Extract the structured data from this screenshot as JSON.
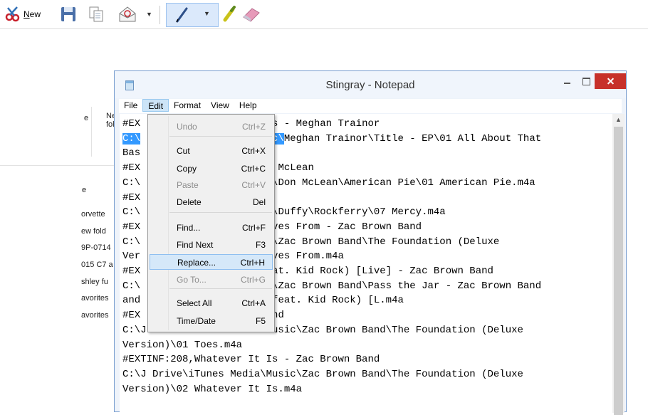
{
  "toolbar": {
    "new_label": "New"
  },
  "explorer": {
    "fragments": [
      "e",
      "Ne",
      "fol",
      "e",
      "orvette",
      "ew fold",
      "9P-0714",
      "015 C7 a",
      "shley fu",
      "avorites",
      "avorites"
    ]
  },
  "notepad": {
    "title": "Stingray - Notepad",
    "menu": [
      "File",
      "Edit",
      "Format",
      "View",
      "Help"
    ],
    "lines": [
      {
        "pre": "#EX",
        "sel": "",
        "post": "                   Bass - Meghan Trainor"
      },
      {
        "pre": "",
        "sel": "C:\\",
        "post": "",
        "gap": "                    ",
        "sel2": "sic\\",
        "post2": "Meghan Trainor\\Title - EP\\01 All About That"
      },
      {
        "pre": "Bas",
        "sel": "",
        "post": ""
      },
      {
        "pre": "#EX",
        "sel": "",
        "post": "                   Don McLean"
      },
      {
        "pre": "C:\\",
        "sel": "",
        "post": "                   sic\\Don McLean\\American Pie\\01 American Pie.m4a"
      },
      {
        "pre": "#EX",
        "sel": "",
        "post": ""
      },
      {
        "pre": "C:\\",
        "sel": "",
        "post": "                   sic\\Duffy\\Rockferry\\07 Mercy.m4a"
      },
      {
        "pre": "#EX",
        "sel": "",
        "post": "                   Leaves From - Zac Brown Band"
      },
      {
        "pre": "C:\\",
        "sel": "",
        "post": "                   sic\\Zac Brown Band\\The Foundation (Deluxe"
      },
      {
        "pre": "Ver",
        "sel": "",
        "post": "                   Leaves From.m4a"
      },
      {
        "pre": "#EX",
        "sel": "",
        "post": "                   (feat. Kid Rock) [Live] - Zac Brown Band"
      },
      {
        "pre": "C:\\",
        "sel": "",
        "post": "                   sic\\Zac Brown Band\\Pass the Jar - Zac Brown Band"
      },
      {
        "pre": "and",
        "sel": "",
        "post": "                   e (feat. Kid Rock) [L.m4a"
      },
      {
        "pre": "#EX",
        "sel": "",
        "post": "                 wn Band"
      },
      {
        "pre": "C:\\J Drive\\iTunes Media\\Music\\Zac Brown Band\\The Foundation (Deluxe",
        "sel": "",
        "post": ""
      },
      {
        "pre": "Version)\\01 Toes.m4a",
        "sel": "",
        "post": ""
      },
      {
        "pre": "#EXTINF:208,Whatever It Is - Zac Brown Band",
        "sel": "",
        "post": ""
      },
      {
        "pre": "C:\\J Drive\\iTunes Media\\Music\\Zac Brown Band\\The Foundation (Deluxe",
        "sel": "",
        "post": ""
      },
      {
        "pre": "Version)\\02 Whatever It Is.m4a",
        "sel": "",
        "post": ""
      }
    ]
  },
  "edit_menu": {
    "items": [
      {
        "label": "Undo",
        "shortcut": "Ctrl+Z",
        "enabled": false
      },
      {
        "label": "Cut",
        "shortcut": "Ctrl+X",
        "enabled": true
      },
      {
        "label": "Copy",
        "shortcut": "Ctrl+C",
        "enabled": true
      },
      {
        "label": "Paste",
        "shortcut": "Ctrl+V",
        "enabled": false
      },
      {
        "label": "Delete",
        "shortcut": "Del",
        "enabled": true
      },
      {
        "label": "Find...",
        "shortcut": "Ctrl+F",
        "enabled": true
      },
      {
        "label": "Find Next",
        "shortcut": "F3",
        "enabled": true
      },
      {
        "label": "Replace...",
        "shortcut": "Ctrl+H",
        "enabled": true,
        "highlighted": true
      },
      {
        "label": "Go To...",
        "shortcut": "Ctrl+G",
        "enabled": false
      },
      {
        "label": "Select All",
        "shortcut": "Ctrl+A",
        "enabled": true
      },
      {
        "label": "Time/Date",
        "shortcut": "F5",
        "enabled": true
      }
    ]
  }
}
